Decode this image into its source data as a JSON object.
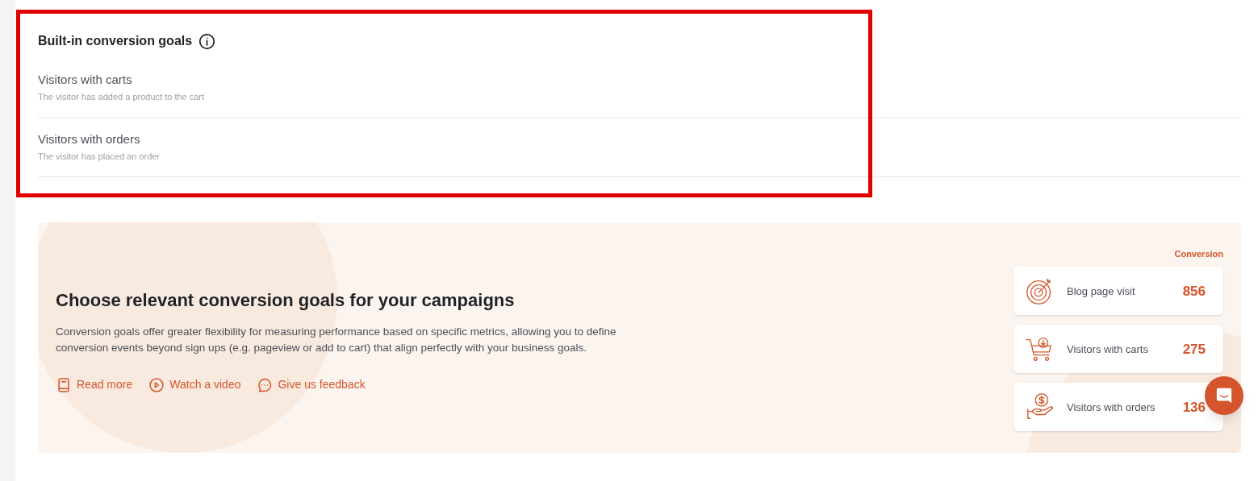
{
  "highlight_frame": true,
  "built_in": {
    "title": "Built-in conversion goals",
    "goals": [
      {
        "name": "Visitors with carts",
        "description": "The visitor has added a product to the cart"
      },
      {
        "name": "Visitors with orders",
        "description": "The visitor has placed an order"
      }
    ]
  },
  "banner": {
    "title": "Choose relevant conversion goals for your campaigns",
    "text": "Conversion goals offer greater flexibility for measuring performance based on specific metrics, allowing you to define conversion events beyond sign ups (e.g. pageview or add to cart) that align perfectly with your business goals.",
    "links": [
      {
        "kind": "book",
        "label": "Read more"
      },
      {
        "kind": "play",
        "label": "Watch a video"
      },
      {
        "kind": "chat",
        "label": "Give us feedback"
      }
    ],
    "stats_heading": "Conversion",
    "stats": [
      {
        "kind": "target",
        "label": "Blog page visit",
        "value": "856"
      },
      {
        "kind": "cart",
        "label": "Visitors with carts",
        "value": "275"
      },
      {
        "kind": "money",
        "label": "Visitors with orders",
        "value": "136"
      }
    ]
  }
}
